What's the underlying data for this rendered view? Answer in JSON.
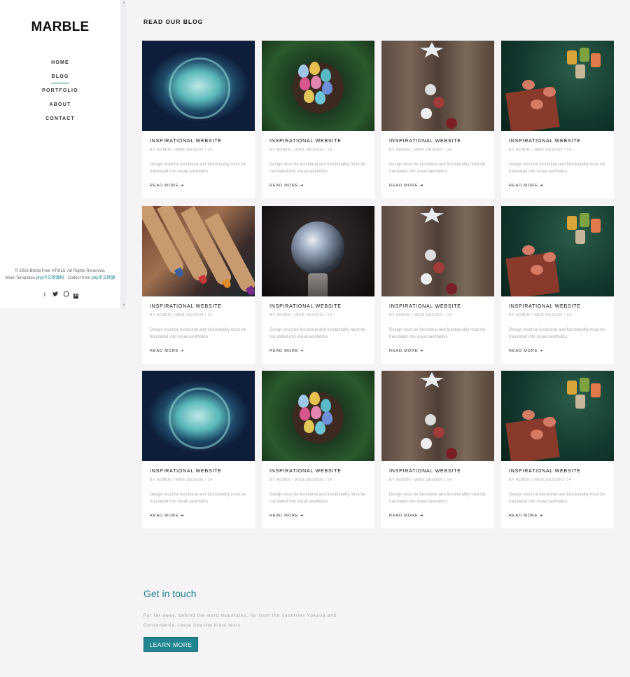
{
  "sidebar": {
    "logo": "MARBLE",
    "nav": [
      {
        "label": "HOME",
        "active": false
      },
      {
        "label": "BLOG",
        "active": true
      },
      {
        "label": "PORTFOLIO",
        "active": false
      },
      {
        "label": "ABOUT",
        "active": false
      },
      {
        "label": "CONTACT",
        "active": false
      }
    ],
    "copyright_line1": "© 2016 Blend Free HTML5. All Rights Reserved.",
    "copyright_line2_prefix": "More Templates ",
    "copyright_line2_link1": "php中文网源码",
    "copyright_line2_mid": " - Collect from ",
    "copyright_line2_link2": "php中文网源",
    "social_icons": [
      "facebook-icon",
      "twitter-icon",
      "instagram-icon",
      "linkedin-icon"
    ]
  },
  "main": {
    "section_title": "READ OUR BLOG",
    "cards": [
      {
        "title": "INSPIRATIONAL WEBSITE",
        "meta": "BY ADMIN / WEB DESIGN / 14",
        "text": "Design must be functional and functionality must be translated into visual aesthetics",
        "more": "READ MORE ➜",
        "image": "jellyfish"
      },
      {
        "title": "INSPIRATIONAL WEBSITE",
        "meta": "BY ADMIN / WEB DESIGN / 14",
        "text": "Design must be functional and functionality must be translated into visual aesthetics",
        "more": "READ MORE ➜",
        "image": "nest"
      },
      {
        "title": "INSPIRATIONAL WEBSITE",
        "meta": "BY ADMIN / WEB DESIGN / 14",
        "text": "Design must be functional and functionality must be translated into visual aesthetics",
        "more": "READ MORE ➜",
        "image": "door"
      },
      {
        "title": "INSPIRATIONAL WEBSITE",
        "meta": "BY ADMIN / WEB DESIGN / 14",
        "text": "Design must be functional and functionality must be translated into visual aesthetics",
        "more": "READ MORE ➜",
        "image": "flowers"
      },
      {
        "title": "INSPIRATIONAL WEBSITE",
        "meta": "BY ADMIN / WEB DESIGN / 14",
        "text": "Design must be functional and functionality must be translated into visual aesthetics",
        "more": "READ MORE ➜",
        "image": "pencils"
      },
      {
        "title": "INSPIRATIONAL WEBSITE",
        "meta": "BY ADMIN / WEB DESIGN / 14",
        "text": "Design must be functional and functionality must be translated into visual aesthetics",
        "more": "READ MORE ➜",
        "image": "globe"
      },
      {
        "title": "INSPIRATIONAL WEBSITE",
        "meta": "BY ADMIN / WEB DESIGN / 14",
        "text": "Design must be functional and functionality must be translated into visual aesthetics",
        "more": "READ MORE ➜",
        "image": "door"
      },
      {
        "title": "INSPIRATIONAL WEBSITE",
        "meta": "BY ADMIN / WEB DESIGN / 14",
        "text": "Design must be functional and functionality must be translated into visual aesthetics",
        "more": "READ MORE ➜",
        "image": "flowers"
      },
      {
        "title": "INSPIRATIONAL WEBSITE",
        "meta": "BY ADMIN / WEB DESIGN / 14",
        "text": "Design must be functional and functionality must be translated into visual aesthetics",
        "more": "READ MORE ➜",
        "image": "jellyfish"
      },
      {
        "title": "INSPIRATIONAL WEBSITE",
        "meta": "BY ADMIN / WEB DESIGN / 14",
        "text": "Design must be functional and functionality must be translated into visual aesthetics",
        "more": "READ MORE ➜",
        "image": "nest"
      },
      {
        "title": "INSPIRATIONAL WEBSITE",
        "meta": "BY ADMIN / WEB DESIGN / 14",
        "text": "Design must be functional and functionality must be translated into visual aesthetics",
        "more": "READ MORE ➜",
        "image": "door"
      },
      {
        "title": "INSPIRATIONAL WEBSITE",
        "meta": "BY ADMIN / WEB DESIGN / 14",
        "text": "Design must be functional and functionality must be translated into visual aesthetics",
        "more": "READ MORE ➜",
        "image": "flowers"
      }
    ]
  },
  "contact": {
    "title": "Get in touch",
    "text": "Far far away, behind the word mountains, far from the countries Vokalia and Consonantia, there live the blind texts.",
    "button_label": "LEARN MORE"
  },
  "colors": {
    "accent": "#1f8591",
    "background": "#f5f3f6"
  }
}
